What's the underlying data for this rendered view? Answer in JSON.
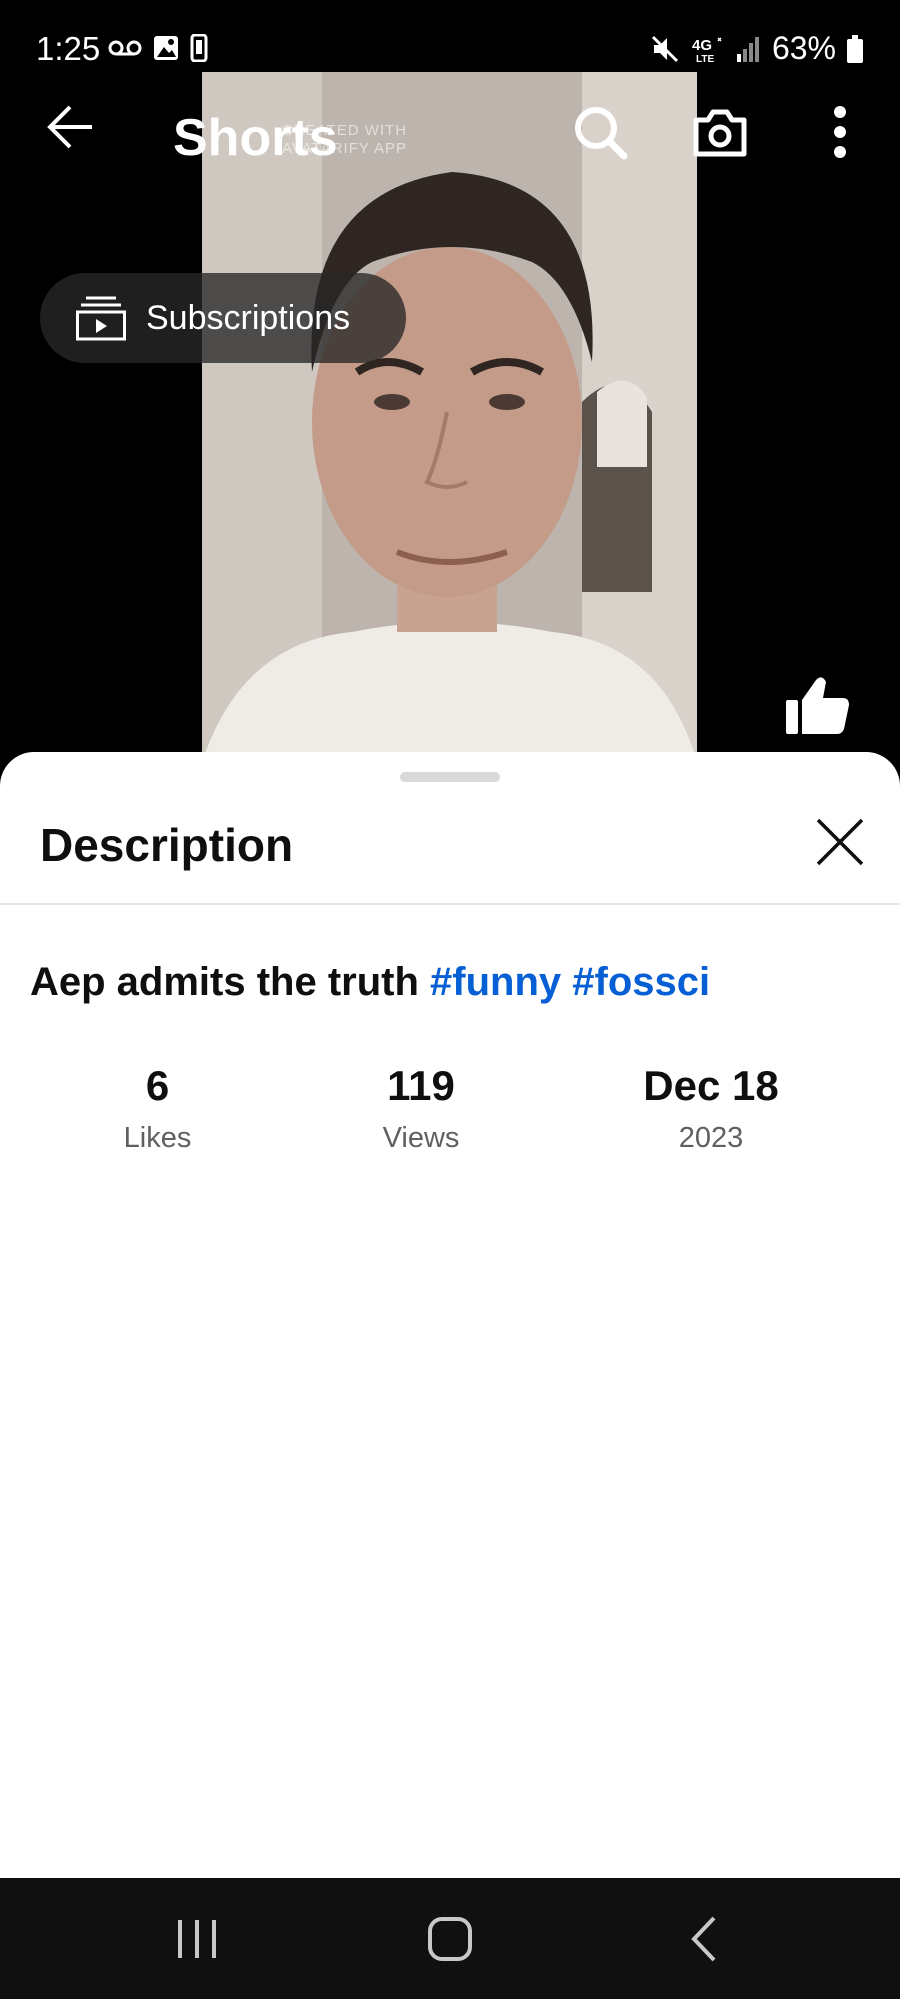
{
  "status_bar": {
    "time": "1:25",
    "battery": "63%",
    "left_icons": [
      "voicemail-icon",
      "image-icon",
      "phone-icon"
    ],
    "right_icons": [
      "mute-icon",
      "4g-lte-icon",
      "signal-icon",
      "battery-icon"
    ],
    "network": "4G LTE"
  },
  "header": {
    "title": "Shorts"
  },
  "video": {
    "watermark_line1": "CREATED WITH",
    "watermark_line2": "AVATARIFY APP"
  },
  "chip": {
    "label": "Subscriptions"
  },
  "sheet": {
    "title": "Description",
    "description_text": "Aep admits the truth",
    "hashtags": [
      "#funny",
      "#fossci"
    ],
    "stats": {
      "likes_value": "6",
      "likes_label": "Likes",
      "views_value": "119",
      "views_label": "Views",
      "date_value": "Dec 18",
      "date_year": "2023"
    }
  },
  "colors": {
    "accent_link": "#065fd4",
    "sheet_bg": "#ffffff",
    "page_bg": "#000000"
  }
}
